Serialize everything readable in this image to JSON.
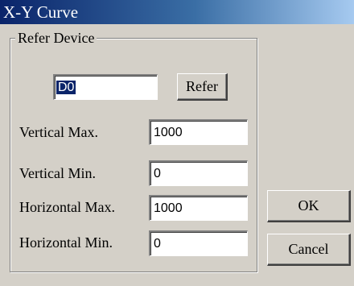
{
  "window": {
    "title": "X-Y Curve"
  },
  "refer_device": {
    "group_label": "Refer Device",
    "device_value": "D0",
    "refer_button": "Refer"
  },
  "vertical_max": {
    "label": "Vertical Max.",
    "value": "1000"
  },
  "vertical_min": {
    "label": "Vertical Min.",
    "value": "0"
  },
  "horizontal_max": {
    "label": "Horizontal Max.",
    "value": "1000"
  },
  "horizontal_min": {
    "label": "Horizontal Min.",
    "value": "0"
  },
  "buttons": {
    "ok": "OK",
    "cancel": "Cancel"
  },
  "colors": {
    "title_bar": "#0a246a",
    "face": "#d4d0c8",
    "selection": "#0a246a"
  }
}
